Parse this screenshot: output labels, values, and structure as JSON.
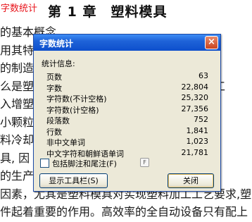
{
  "document": {
    "label": "字数统计",
    "heading": "第 1 章　塑料模具",
    "lines": [
      "的基本概念",
      "用其特　　　　　　　　　　　　　的塑料",
      "的制造质",
      "么是塑料　　　　　　　　　　　　是由从工",
      "入增塑剂　　　　　　　　　　　　为小颗",
      "小颗粒料　　　　　　　　　　　具有所",
      "料冷却后　　　　　　　　　　　的塑件",
      "具, 因　　　　　　　　　　　　称为塑",
      "的生产中　　　　　　　　　　先进的",
      "因素，尤其是塑料模具对实现塑料加工工艺要求,塑",
      "件起着重要的作用。高效率的全自动设备只有配上"
    ]
  },
  "dialog": {
    "title": "字数统计",
    "close_glyph": "×",
    "group_label": "统计信息:",
    "stats": [
      {
        "label": "页数",
        "value": "63"
      },
      {
        "label": "字数",
        "value": "22,804"
      },
      {
        "label": "字符数(不计空格)",
        "value": "25,320"
      },
      {
        "label": "字符数(计空格)",
        "value": "27,356"
      },
      {
        "label": "段落数",
        "value": "752"
      },
      {
        "label": "行数",
        "value": "1,841"
      },
      {
        "label": "非中文单词",
        "value": "1,023"
      },
      {
        "label": "中文字符和朝鲜语单词",
        "value": "21,781"
      }
    ],
    "checkbox_label": "包括脚注和尾注(F)",
    "checkbox_checked": false,
    "toolbar_button": "显示工具栏(S)",
    "close_button": "关闭"
  }
}
